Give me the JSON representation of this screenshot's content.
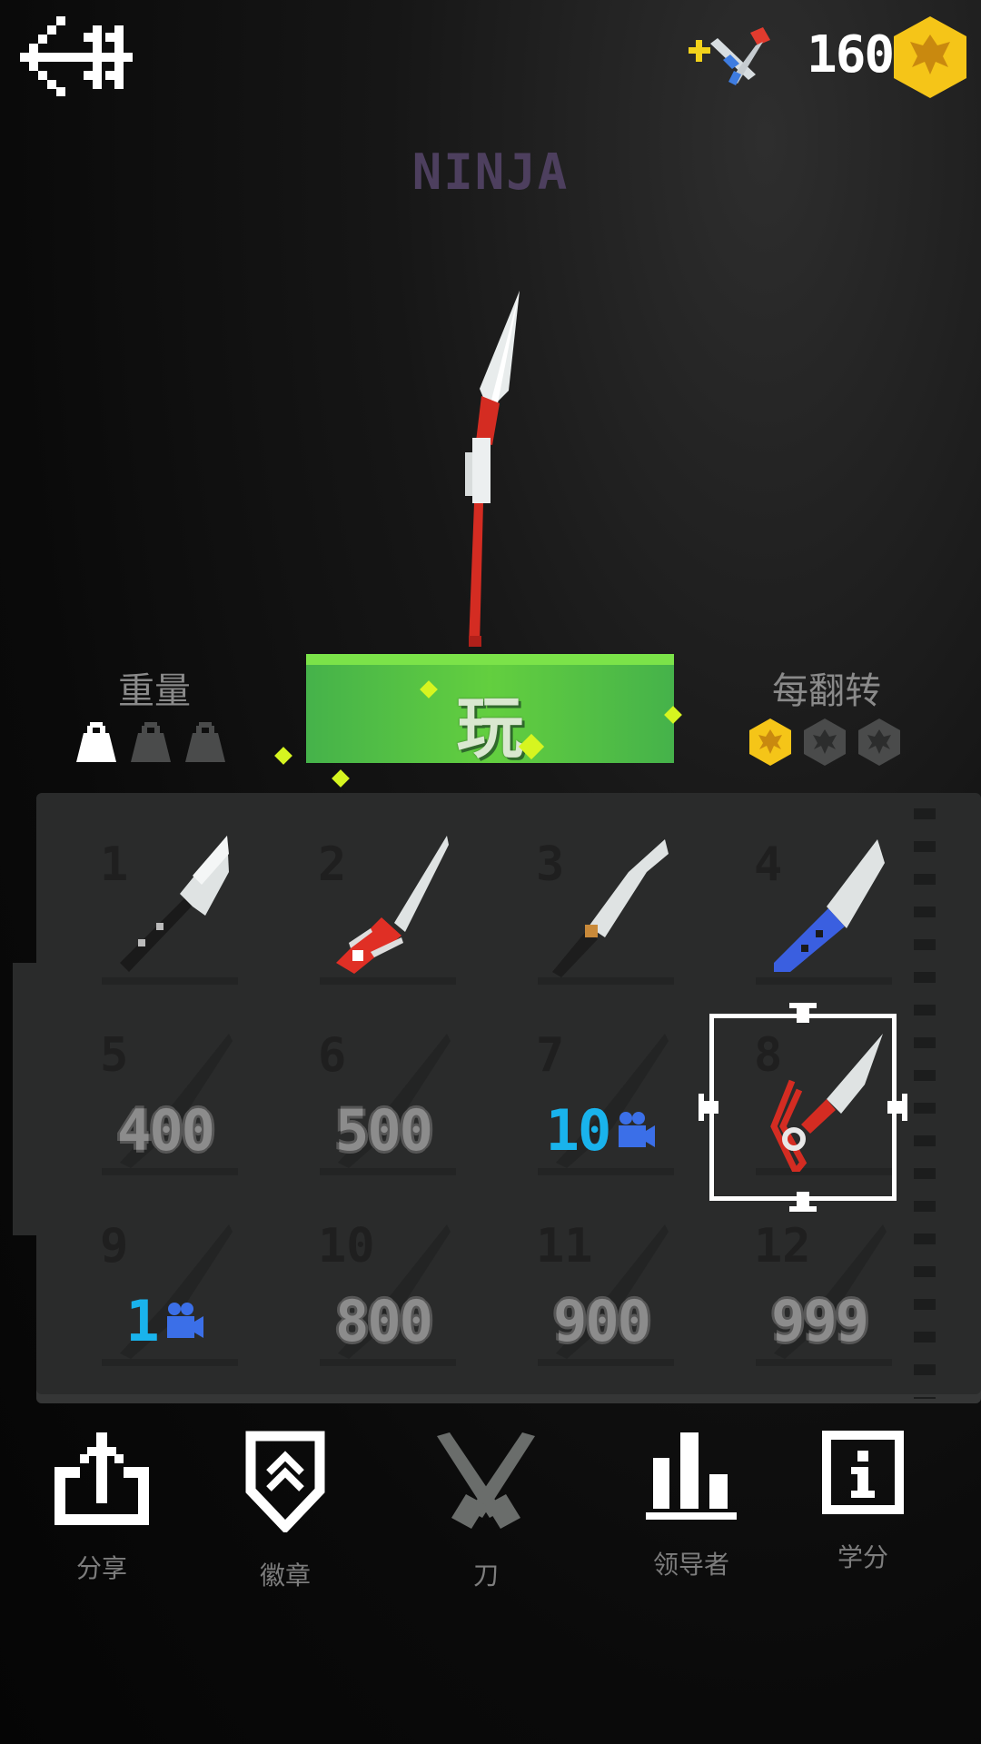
{
  "header": {
    "coins": "160",
    "knife_name": "NINJA"
  },
  "stats": {
    "weight_label": "重量",
    "weight_level": 1,
    "weight_max": 3,
    "flip_label": "每翻转",
    "flip_reward": 1,
    "flip_max": 3
  },
  "play_label": "玩",
  "grid": {
    "slots": [
      {
        "num": "1",
        "state": "unlocked"
      },
      {
        "num": "2",
        "state": "unlocked"
      },
      {
        "num": "3",
        "state": "unlocked"
      },
      {
        "num": "4",
        "state": "unlocked"
      },
      {
        "num": "5",
        "state": "locked",
        "price": "400"
      },
      {
        "num": "6",
        "state": "locked",
        "price": "500"
      },
      {
        "num": "7",
        "state": "ad",
        "price": "10"
      },
      {
        "num": "8",
        "state": "selected"
      },
      {
        "num": "9",
        "state": "ad",
        "price": "1"
      },
      {
        "num": "10",
        "state": "locked",
        "price": "800"
      },
      {
        "num": "11",
        "state": "locked",
        "price": "900"
      },
      {
        "num": "12",
        "state": "locked",
        "price": "999"
      }
    ]
  },
  "nav": {
    "share": "分享",
    "badges": "徽章",
    "knives": "刀",
    "leaders": "领导者",
    "credits": "学分"
  },
  "colors": {
    "play_green": "#5cc445",
    "coin_gold": "#f5c518",
    "ad_blue": "#19b3ec",
    "panel": "#2a2b2b"
  },
  "icons": [
    "back-arrow-icon",
    "shop-knives-icon",
    "coin-icon",
    "weight-icon",
    "coin-badge-icon",
    "video-ad-icon",
    "share-icon",
    "badge-shield-icon",
    "crossed-knives-icon",
    "leaderboard-icon",
    "info-icon"
  ]
}
